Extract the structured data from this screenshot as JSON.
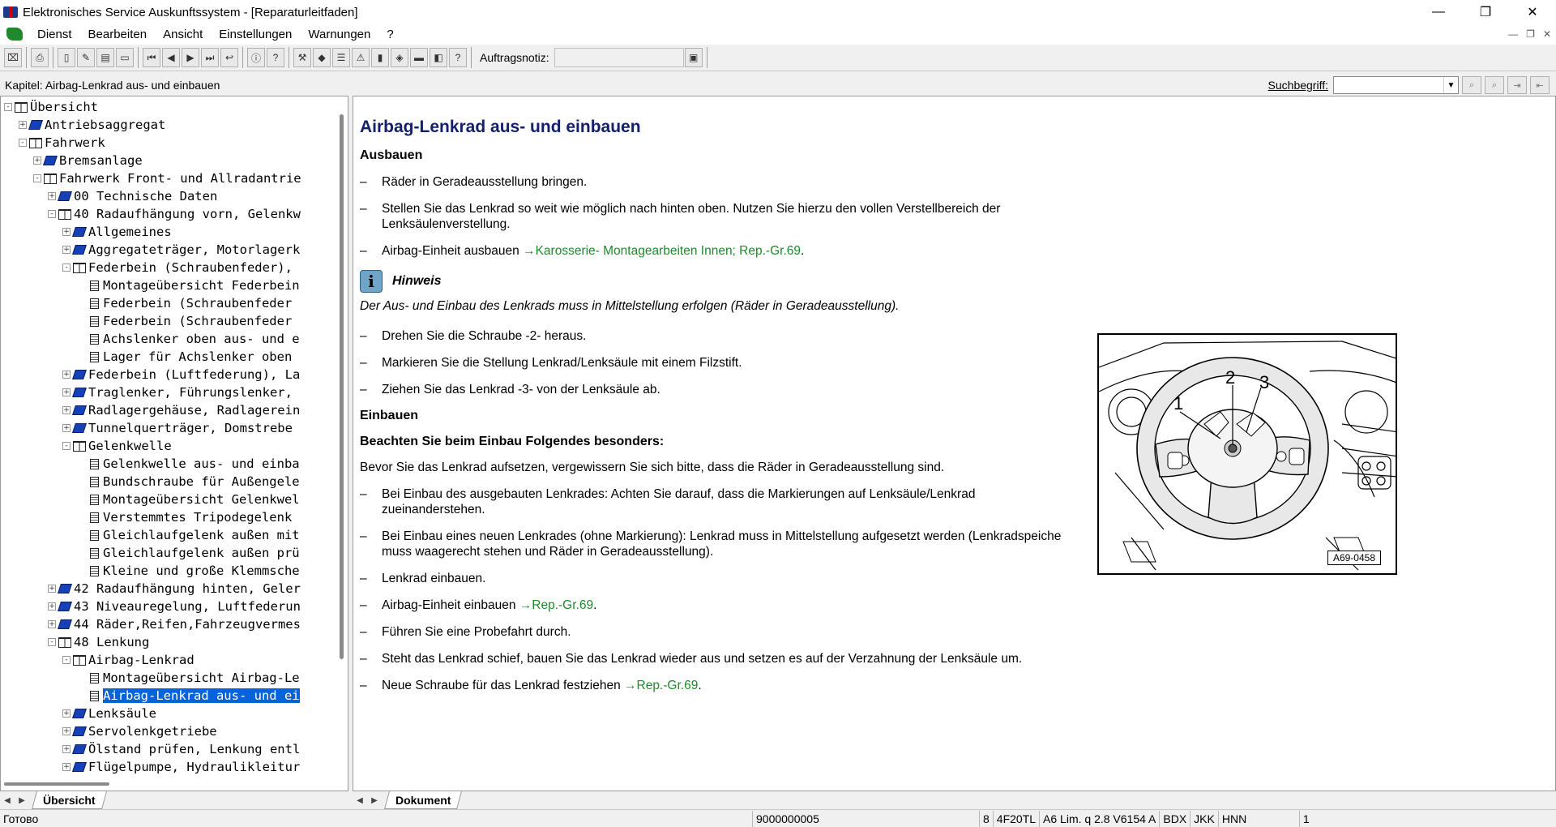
{
  "window": {
    "title": "Elektronisches Service Auskunftssystem - [Reparaturleitfaden]",
    "controls": [
      "—",
      "❐",
      "✕"
    ]
  },
  "menu": {
    "items": [
      "Dienst",
      "Bearbeiten",
      "Ansicht",
      "Einstellungen",
      "Warnungen",
      "?"
    ],
    "mdi_controls": [
      "—",
      "❐",
      "✕"
    ]
  },
  "toolbar": {
    "order_note_label": "Auftragsnotiz:"
  },
  "chapter": {
    "label": "Kapitel: Airbag-Lenkrad aus- und einbauen"
  },
  "search": {
    "label": "Suchbegriff:",
    "value": ""
  },
  "tree": [
    {
      "level": 0,
      "expander": "-",
      "icon": "open",
      "label": "Übersicht"
    },
    {
      "level": 1,
      "expander": "+",
      "icon": "closed",
      "label": "Antriebsaggregat"
    },
    {
      "level": 1,
      "expander": "-",
      "icon": "open",
      "label": "Fahrwerk"
    },
    {
      "level": 2,
      "expander": "+",
      "icon": "closed",
      "label": "Bremsanlage"
    },
    {
      "level": 2,
      "expander": "-",
      "icon": "open",
      "label": "Fahrwerk Front- und Allradantrie"
    },
    {
      "level": 3,
      "expander": "+",
      "icon": "closed",
      "label": "00 Technische Daten"
    },
    {
      "level": 3,
      "expander": "-",
      "icon": "open",
      "label": "40 Radaufhängung vorn, Gelenkw"
    },
    {
      "level": 4,
      "expander": "+",
      "icon": "closed",
      "label": "Allgemeines"
    },
    {
      "level": 4,
      "expander": "+",
      "icon": "closed",
      "label": "Aggregateträger, Motorlagerk"
    },
    {
      "level": 4,
      "expander": "-",
      "icon": "open",
      "label": "Federbein (Schraubenfeder),"
    },
    {
      "level": 5,
      "expander": "",
      "icon": "doc",
      "label": "Montageübersicht Federbein"
    },
    {
      "level": 5,
      "expander": "",
      "icon": "doc",
      "label": "Federbein (Schraubenfeder"
    },
    {
      "level": 5,
      "expander": "",
      "icon": "doc",
      "label": "Federbein (Schraubenfeder"
    },
    {
      "level": 5,
      "expander": "",
      "icon": "doc",
      "label": "Achslenker oben aus- und e"
    },
    {
      "level": 5,
      "expander": "",
      "icon": "doc",
      "label": "Lager für Achslenker oben"
    },
    {
      "level": 4,
      "expander": "+",
      "icon": "closed",
      "label": "Federbein (Luftfederung), La"
    },
    {
      "level": 4,
      "expander": "+",
      "icon": "closed",
      "label": "Traglenker, Führungslenker,"
    },
    {
      "level": 4,
      "expander": "+",
      "icon": "closed",
      "label": "Radlagergehäuse, Radlagerein"
    },
    {
      "level": 4,
      "expander": "+",
      "icon": "closed",
      "label": "Tunnelquerträger, Domstrebe"
    },
    {
      "level": 4,
      "expander": "-",
      "icon": "open",
      "label": "Gelenkwelle"
    },
    {
      "level": 5,
      "expander": "",
      "icon": "doc",
      "label": "Gelenkwelle aus- und einba"
    },
    {
      "level": 5,
      "expander": "",
      "icon": "doc",
      "label": "Bundschraube für Außengele"
    },
    {
      "level": 5,
      "expander": "",
      "icon": "doc",
      "label": "Montageübersicht Gelenkwel"
    },
    {
      "level": 5,
      "expander": "",
      "icon": "doc",
      "label": "Verstemmtes Tripodegelenk"
    },
    {
      "level": 5,
      "expander": "",
      "icon": "doc",
      "label": "Gleichlaufgelenk außen mit"
    },
    {
      "level": 5,
      "expander": "",
      "icon": "doc",
      "label": "Gleichlaufgelenk außen prü"
    },
    {
      "level": 5,
      "expander": "",
      "icon": "doc",
      "label": "Kleine und große Klemmsche"
    },
    {
      "level": 3,
      "expander": "+",
      "icon": "closed",
      "label": "42 Radaufhängung hinten, Geler"
    },
    {
      "level": 3,
      "expander": "+",
      "icon": "closed",
      "label": "43 Niveauregelung, Luftfederun"
    },
    {
      "level": 3,
      "expander": "+",
      "icon": "closed",
      "label": "44 Räder,Reifen,Fahrzeugvermes"
    },
    {
      "level": 3,
      "expander": "-",
      "icon": "open",
      "label": "48 Lenkung"
    },
    {
      "level": 4,
      "expander": "-",
      "icon": "open",
      "label": "Airbag-Lenkrad"
    },
    {
      "level": 5,
      "expander": "",
      "icon": "doc",
      "label": "Montageübersicht Airbag-Le"
    },
    {
      "level": 5,
      "expander": "",
      "icon": "doc",
      "label": "Airbag-Lenkrad aus- und ei",
      "selected": true
    },
    {
      "level": 4,
      "expander": "+",
      "icon": "closed",
      "label": "Lenksäule"
    },
    {
      "level": 4,
      "expander": "+",
      "icon": "closed",
      "label": "Servolenkgetriebe"
    },
    {
      "level": 4,
      "expander": "+",
      "icon": "closed",
      "label": "Ölstand prüfen, Lenkung entl"
    },
    {
      "level": 4,
      "expander": "+",
      "icon": "closed",
      "label": "Flügelpumpe, Hydraulikleitur"
    }
  ],
  "document": {
    "title": "Airbag-Lenkrad aus- und einbauen",
    "removal_heading": "Ausbauen",
    "b1": "Räder in Geradeausstellung bringen.",
    "b2": "Stellen Sie das Lenkrad so weit wie möglich nach hinten oben. Nutzen Sie hierzu den vollen Verstellbereich der Lenksäulenverstellung.",
    "b3_text": "Airbag-Einheit ausbauen ",
    "b3_link": "→Karosserie- Montagearbeiten Innen; Rep.-Gr.69",
    "b3_end": ".",
    "note_icon": "i",
    "note_title": "Hinweis",
    "note_text": "Der Aus- und Einbau des Lenkrads muss in Mittelstellung erfolgen (Räder in Geradeausstellung).",
    "b4": "Drehen Sie die Schraube -2- heraus.",
    "b5": "Markieren Sie die Stellung Lenkrad/Lenksäule mit einem Filzstift.",
    "b6": "Ziehen Sie das Lenkrad -3- von der Lenksäule ab.",
    "install_heading": "Einbauen",
    "install_sub": "Beachten Sie beim Einbau Folgendes besonders:",
    "install_intro": "Bevor Sie das Lenkrad aufsetzen, vergewissern Sie sich bitte, dass die Räder in Geradeausstellung sind.",
    "i1": "Bei Einbau des ausgebauten Lenkrades: Achten Sie darauf, dass die Markierungen auf Lenksäule/Lenkrad zueinanderstehen.",
    "i2": "Bei Einbau eines neuen Lenkrades (ohne Markierung): Lenkrad muss in Mittelstellung aufgesetzt werden (Lenkradspeiche muss waagerecht stehen und Räder in Geradeausstellung).",
    "i3": "Lenkrad einbauen.",
    "i4_text": "Airbag-Einheit einbauen ",
    "i4_link": "→Rep.-Gr.69",
    "i4_end": ".",
    "i5": "Führen Sie eine Probefahrt durch.",
    "i6": "Steht das Lenkrad schief, bauen Sie das Lenkrad wieder aus und setzen es auf der Verzahnung der Lenksäule um.",
    "i7_text": "Neue Schraube für das Lenkrad festziehen ",
    "i7_link": "→Rep.-Gr.69",
    "i7_end": ".",
    "dash": "–"
  },
  "figure": {
    "id": "A69-0458",
    "labels": [
      "1",
      "2",
      "3"
    ]
  },
  "tabs": {
    "left": "Übersicht",
    "right": "Dokument"
  },
  "status": {
    "main": "Готово",
    "cells": [
      "9000000005",
      "8",
      "4F20TL",
      "A6 Lim. q 2.8 V6154 A",
      "BDX",
      "JKK",
      "HNN",
      "1"
    ]
  },
  "colors": {
    "title": "#14206c",
    "link": "#1e8a2c",
    "selection": "#0a62d8"
  }
}
